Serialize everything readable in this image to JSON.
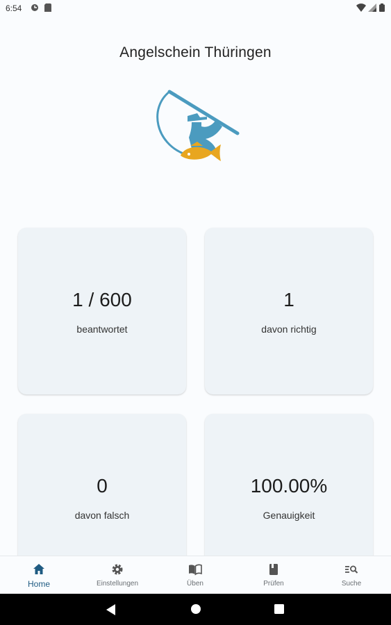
{
  "status_bar": {
    "time": "6:54"
  },
  "app": {
    "title": "Angelschein Thüringen"
  },
  "stats": [
    {
      "value": "1 / 600",
      "label": "beantwortet"
    },
    {
      "value": "1",
      "label": "davon richtig"
    },
    {
      "value": "0",
      "label": "davon falsch"
    },
    {
      "value": "100.00%",
      "label": "Genauigkeit"
    }
  ],
  "nav": {
    "active_color": "#1f5b82",
    "items": [
      {
        "label": "Home",
        "icon": "home-icon"
      },
      {
        "label": "Einstellungen",
        "icon": "gear-icon"
      },
      {
        "label": "Üben",
        "icon": "book-open-icon"
      },
      {
        "label": "Prüfen",
        "icon": "book-closed-icon"
      },
      {
        "label": "Suche",
        "icon": "search-list-icon"
      }
    ]
  },
  "colors": {
    "background": "#fafcfe",
    "card": "#eef3f7",
    "logo_blue": "#4b9bbf",
    "logo_orange": "#e8a620"
  }
}
